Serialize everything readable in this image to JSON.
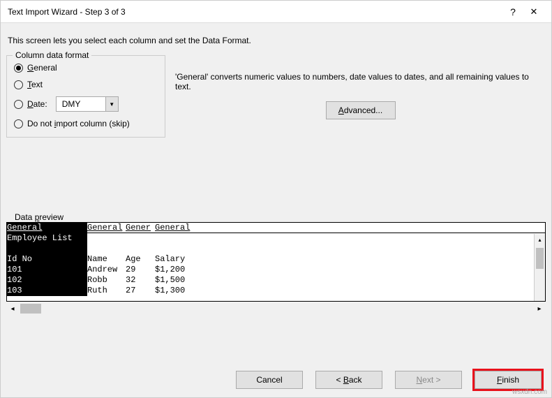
{
  "window": {
    "title": "Text Import Wizard - Step 3 of 3",
    "help": "?",
    "close": "✕"
  },
  "instruction": "This screen lets you select each column and set the Data Format.",
  "format_group": {
    "legend": "Column data format",
    "options": {
      "general": "General",
      "text": "Text",
      "date": "Date:",
      "skip": "Do not import column (skip)"
    },
    "date_value": "DMY",
    "desc": "'General' converts numeric values to numbers, date values to dates, and all remaining values to text.",
    "advanced": "Advanced..."
  },
  "preview": {
    "legend": "Data preview",
    "headers": [
      "General",
      "General",
      "Gener",
      "General"
    ],
    "columns": [
      [
        "Employee List",
        "",
        "Id No",
        "101",
        "102",
        "103"
      ],
      [
        "",
        "",
        "Name",
        "Andrew",
        "Robb",
        "Ruth"
      ],
      [
        "",
        "",
        "Age",
        "29",
        "32",
        "27"
      ],
      [
        "",
        "",
        "Salary",
        "$1,200",
        "$1,500",
        "$1,300"
      ]
    ],
    "widths": [
      115,
      55,
      42,
      524
    ]
  },
  "buttons": {
    "cancel": "Cancel",
    "back": "< Back",
    "next": "Next >",
    "finish": "Finish"
  },
  "watermark": "wsxdn.com"
}
